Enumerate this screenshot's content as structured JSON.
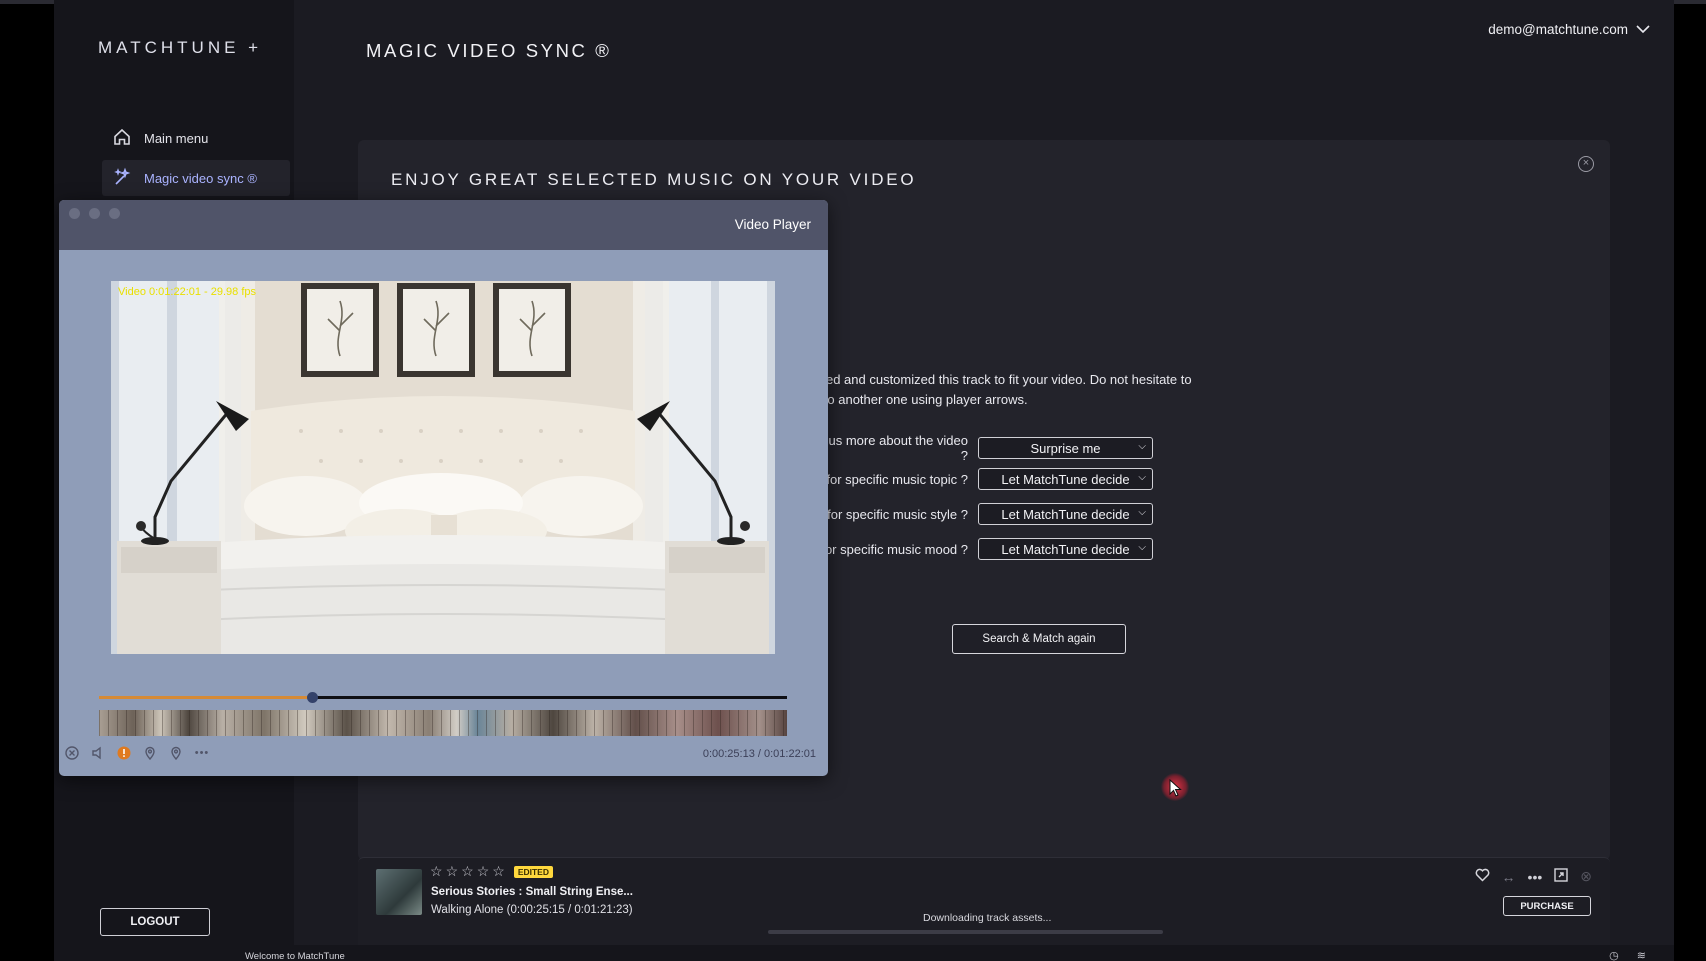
{
  "app": {
    "logo": "MATCHTUNE +",
    "header_title": "MAGIC VIDEO SYNC ®",
    "user_email": "demo@matchtune.com"
  },
  "sidebar": {
    "items": [
      {
        "label": "Main menu",
        "icon": "home-icon"
      },
      {
        "label": "Magic video sync ®",
        "icon": "magic-wand-icon"
      }
    ],
    "logout_label": "LOGOUT"
  },
  "panel": {
    "heading": "ENJOY GREAT SELECTED MUSIC ON YOUR VIDEO",
    "description": "selected and customized this track to fit your video. Do not hesitate to jump to another one using player arrows.",
    "questions": [
      {
        "label": "to tell us more about the video ?",
        "value": "Surprise me"
      },
      {
        "label": "ing for specific music topic ?",
        "value": "Let MatchTune decide"
      },
      {
        "label": "ing for specific music style ?",
        "value": "Let MatchTune decide"
      },
      {
        "label": "ing for specific music mood ?",
        "value": "Let MatchTune decide"
      }
    ],
    "search_button": "Search & Match again"
  },
  "video_player": {
    "title": "Video Player",
    "overlay": "Video 0:01:22:01 - 29.98 fps",
    "progress": 0.31,
    "time": "0:00:25:13 / 0:01:22:01"
  },
  "track": {
    "rating": 0,
    "max_rating": 5,
    "badge": "EDITED",
    "title": "Serious Stories : Small String Ense...",
    "subtitle": "Walking Alone (0:00:25:15 / 0:01:21:23)",
    "status": "Downloading track assets...",
    "purchase_label": "PURCHASE"
  },
  "statusbar": {
    "text": "Welcome to MatchTune"
  },
  "colors": {
    "accent": "#aab3ff",
    "progress": "#d68a35",
    "badge": "#ffd83d",
    "cursor": "#e03244"
  }
}
